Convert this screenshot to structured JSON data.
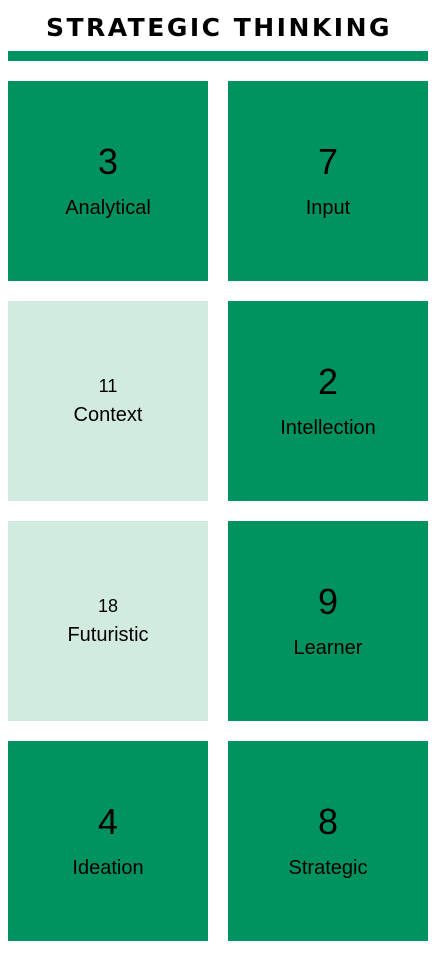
{
  "title": "STRATEGIC THINKING",
  "colors": {
    "strong": "#00935f",
    "weak": "#d2ebe1",
    "bar": "#00935f"
  },
  "tiles": [
    {
      "rank": "3",
      "name": "Analytical",
      "level": "strong"
    },
    {
      "rank": "7",
      "name": "Input",
      "level": "strong"
    },
    {
      "rank": "11",
      "name": "Context",
      "level": "weak"
    },
    {
      "rank": "2",
      "name": "Intellection",
      "level": "strong"
    },
    {
      "rank": "18",
      "name": "Futuristic",
      "level": "weak"
    },
    {
      "rank": "9",
      "name": "Learner",
      "level": "strong"
    },
    {
      "rank": "4",
      "name": "Ideation",
      "level": "strong"
    },
    {
      "rank": "8",
      "name": "Strategic",
      "level": "strong"
    }
  ]
}
